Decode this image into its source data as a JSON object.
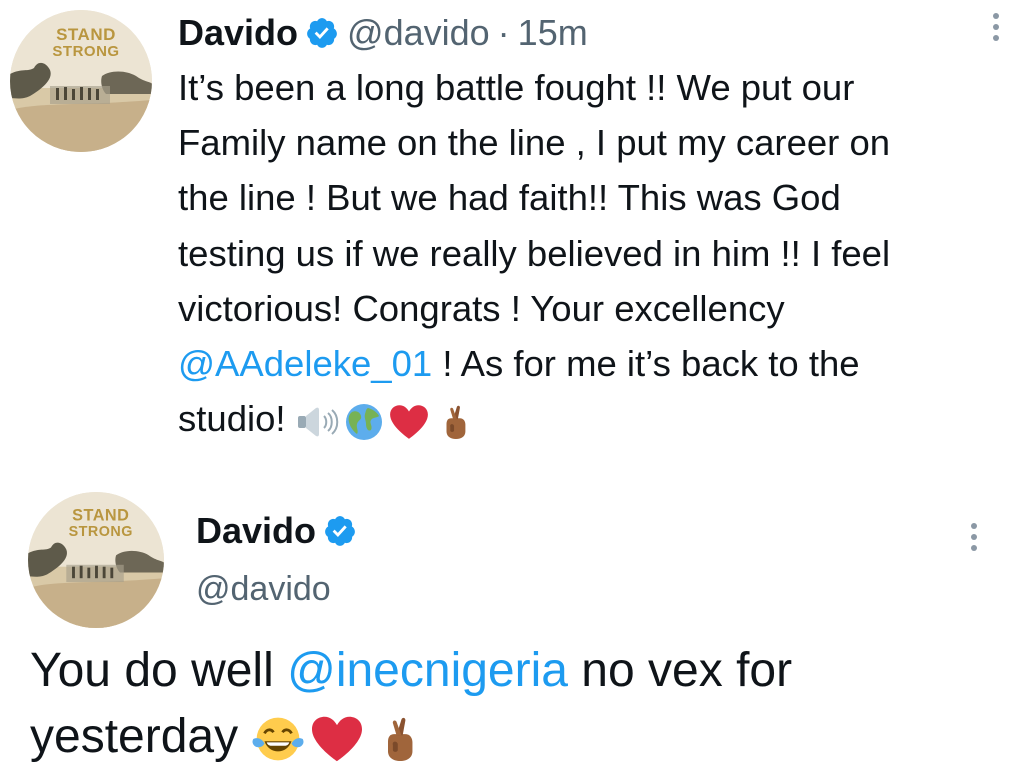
{
  "tweets": [
    {
      "avatar": {
        "top_text": "STAND",
        "bottom_text": "STRONG"
      },
      "name": "Davido",
      "handle": "@davido",
      "separator": "·",
      "time": "15m",
      "body_lines": [
        "It’s been a long battle fought !! We put our",
        "Family name on the line , I put my career on",
        "the line ! But we had faith!! This was God",
        "testing us if we really believed in him !! I feel",
        "victorious! Congrats ! Your excellency"
      ],
      "mention": "@AAdeleke_01",
      "after_mention": " ! As for me it’s back to the",
      "last_line": "studio! ",
      "emojis": [
        "speaker-icon",
        "globe-icon",
        "heart-icon",
        "crossed-fingers-icon"
      ]
    },
    {
      "avatar": {
        "top_text": "STAND",
        "bottom_text": "STRONG"
      },
      "name": "Davido",
      "handle": "@davido",
      "body_before": "You do well ",
      "mention": "@inecnigeria",
      "body_after": " no vex for",
      "line2": "yesterday ",
      "emojis": [
        "tears-of-joy-icon",
        "heart-icon",
        "crossed-fingers-icon"
      ]
    }
  ],
  "colors": {
    "text": "#0f1419",
    "secondary": "#536471",
    "link": "#1d9bf0",
    "verified": "#1d9bf0"
  }
}
